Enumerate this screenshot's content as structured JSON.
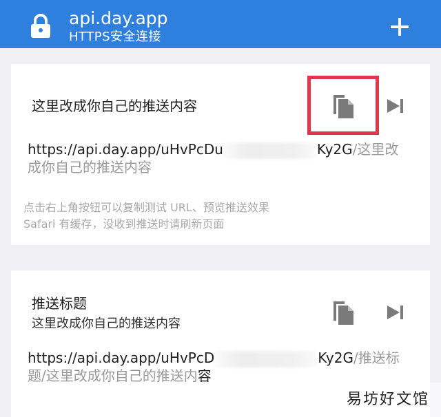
{
  "header": {
    "title": "api.day.app",
    "subtitle": "HTTPS安全连接",
    "bg_color": "#2f7fde"
  },
  "cards": [
    {
      "title": "这里改成你自己的推送内容",
      "url": {
        "line1_dark_prefix": "https://api.day.app/uHvPcDu",
        "line1_dark_suffix": "Ky2G",
        "line1_grey": "/这里改",
        "line2_grey": "成你自己的推送内容"
      },
      "hints": [
        "点击右上角按钮可以复制测试 URL、预览推送效果",
        "Safari 有缓存，没收到推送时请刷新页面"
      ],
      "copy_icon": "copy-icon",
      "preview_icon": "skip-next-icon",
      "highlight_color": "#e0374c"
    },
    {
      "title": "推送标题",
      "subtitle": "这里改成你自己的推送内容",
      "url": {
        "line1_dark_prefix": "https://api.day.app/uHvPcD",
        "line1_dark_suffix": "Ky2G",
        "line1_grey": "/推送标",
        "line2_grey_1": "题/这里改成你自己的推送内",
        "line2_dark": "容"
      },
      "copy_icon": "copy-icon",
      "preview_icon": "skip-next-icon"
    }
  ],
  "watermark": "易坊好文馆"
}
